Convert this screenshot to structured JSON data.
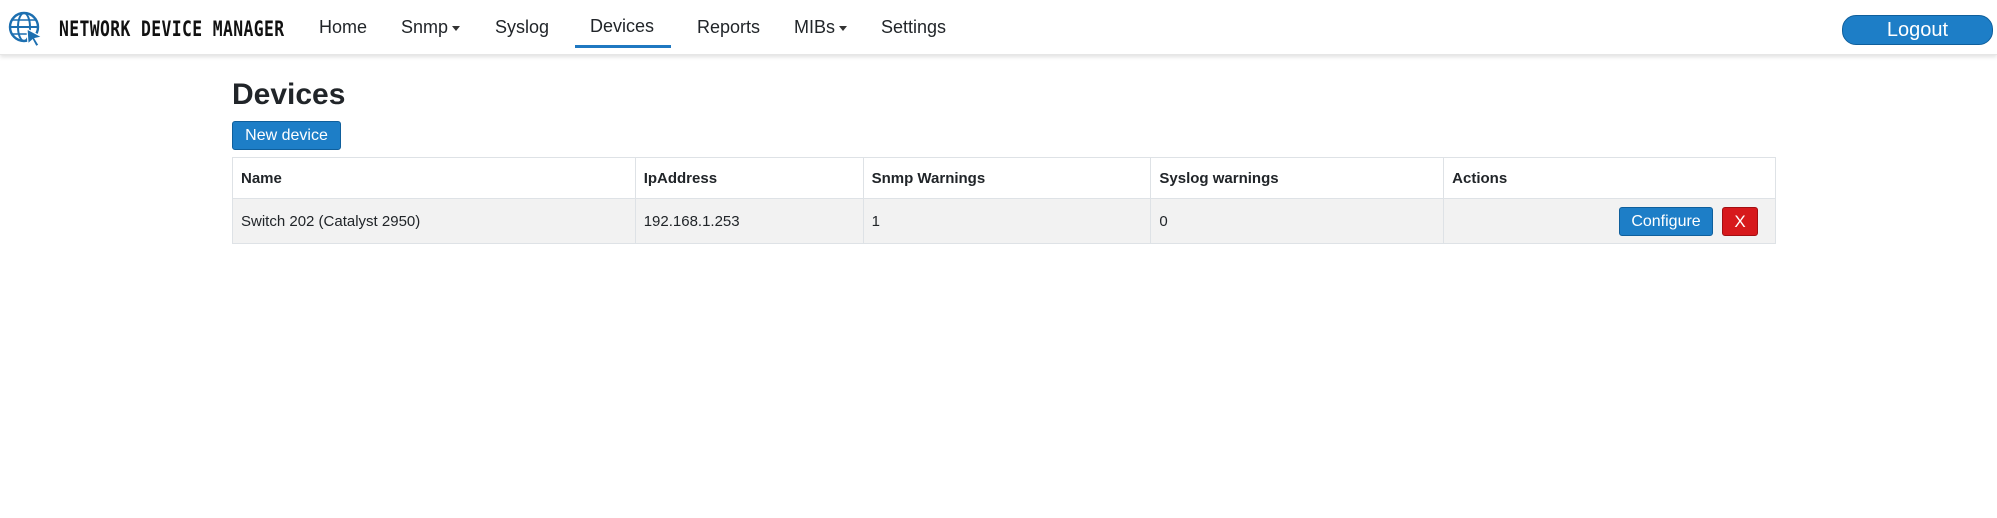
{
  "brand": {
    "title": "NETWORK DEVICE MANAGER",
    "logo_icon": "globe-cursor-icon"
  },
  "nav": {
    "items": [
      {
        "label": "Home",
        "dropdown": false
      },
      {
        "label": "Snmp",
        "dropdown": true
      },
      {
        "label": "Syslog",
        "dropdown": false
      },
      {
        "label": "Devices",
        "dropdown": false,
        "active": true
      },
      {
        "label": "Reports",
        "dropdown": false
      },
      {
        "label": "MIBs",
        "dropdown": true
      },
      {
        "label": "Settings",
        "dropdown": false
      }
    ],
    "logout_label": "Logout"
  },
  "page": {
    "title": "Devices",
    "new_device_label": "New device"
  },
  "table": {
    "columns": [
      "Name",
      "IpAddress",
      "Snmp Warnings",
      "Syslog warnings",
      "Actions"
    ],
    "rows": [
      {
        "name": "Switch 202 (Catalyst 2950)",
        "ip": "192.168.1.253",
        "snmp_warnings": "1",
        "syslog_warnings": "0",
        "configure_label": "Configure",
        "delete_label": "X"
      }
    ]
  },
  "colors": {
    "primary": "#1d7ec7",
    "danger": "#d7191c",
    "row_bg": "#f2f2f2",
    "active_underline": "#1f78c1"
  }
}
